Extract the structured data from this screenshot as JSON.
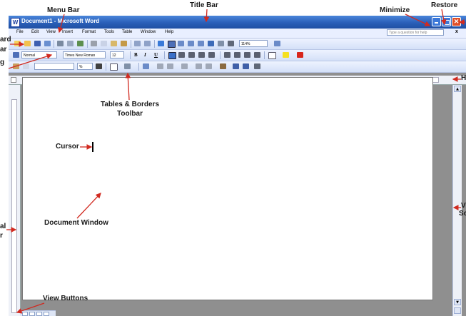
{
  "window": {
    "title": "Document1 - Microsoft Word",
    "app_icon": "W",
    "close_glyph": "✕",
    "titlebar_color": "#2a5fb8"
  },
  "menu": {
    "items": [
      "File",
      "Edit",
      "View",
      "Insert",
      "Format",
      "Tools",
      "Table",
      "Window",
      "Help"
    ],
    "help_placeholder": "Type a question for help",
    "close_glyph": "x"
  },
  "formatting": {
    "style": "Normal",
    "font": "Times New Roman",
    "size": "12",
    "bold": "B",
    "italic": "I",
    "underline": "U"
  },
  "standard": {
    "zoom": "114%"
  },
  "tables_borders": {
    "percent": "%"
  },
  "scroll": {
    "up": "▲",
    "down": "▼"
  },
  "annotations": {
    "title_bar": "Title Bar",
    "menu_bar": "Menu Bar",
    "minimize": "Minimize",
    "restore": "Restore",
    "standard_toolbar": [
      "ard",
      "ar"
    ],
    "formatting_toolbar": "g",
    "tables_borders_toolbar": [
      "Tables & Borders",
      "Toolbar"
    ],
    "cursor": "Cursor",
    "document_window": "Document Window",
    "view_buttons": "View Buttons",
    "vertical_ruler": [
      "al",
      "r"
    ],
    "horizontal_ruler": "H",
    "vertical_scroll": [
      "V",
      "So"
    ]
  },
  "annotation_color": "#d12a20"
}
